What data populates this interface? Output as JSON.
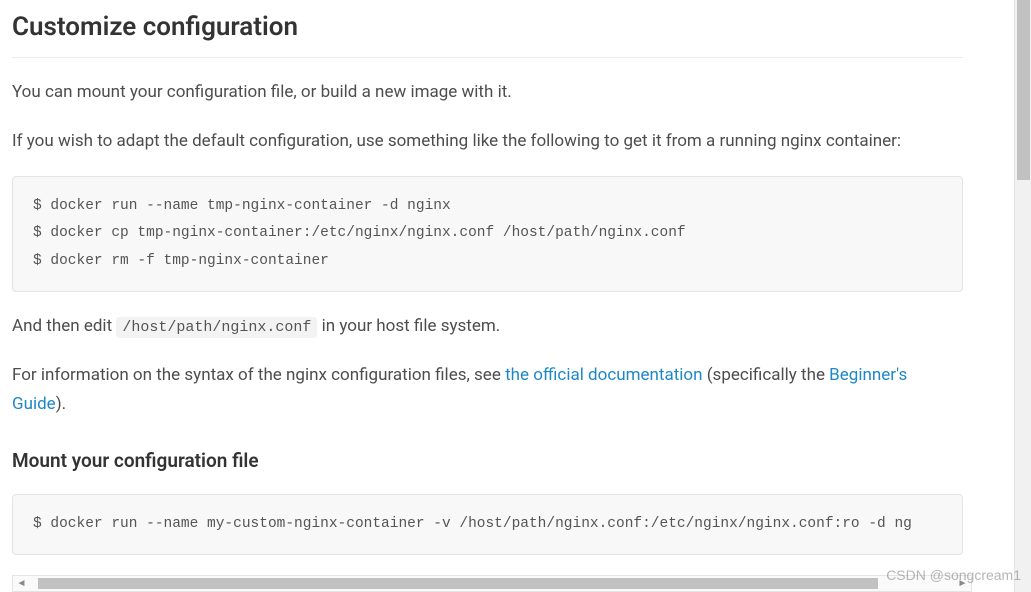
{
  "heading": "Customize configuration",
  "para1": "You can mount your configuration file, or build a new image with it.",
  "para2": "If you wish to adapt the default configuration, use something like the following to get it from a running nginx container:",
  "code1": "$ docker run --name tmp-nginx-container -d nginx\n$ docker cp tmp-nginx-container:/etc/nginx/nginx.conf /host/path/nginx.conf\n$ docker rm -f tmp-nginx-container",
  "para3_a": "And then edit ",
  "para3_code": "/host/path/nginx.conf",
  "para3_b": " in your host file system.",
  "para4_a": "For information on the syntax of the nginx configuration files, see ",
  "para4_link1": "the official documentation",
  "para4_b": " (specifically the ",
  "para4_link2": "Beginner's Guide",
  "para4_c": ").",
  "subheading": "Mount your configuration file",
  "code2": "$ docker run --name my-custom-nginx-container -v /host/path/nginx.conf:/etc/nginx/nginx.conf:ro -d ng",
  "watermark": "CSDN @songcream1"
}
